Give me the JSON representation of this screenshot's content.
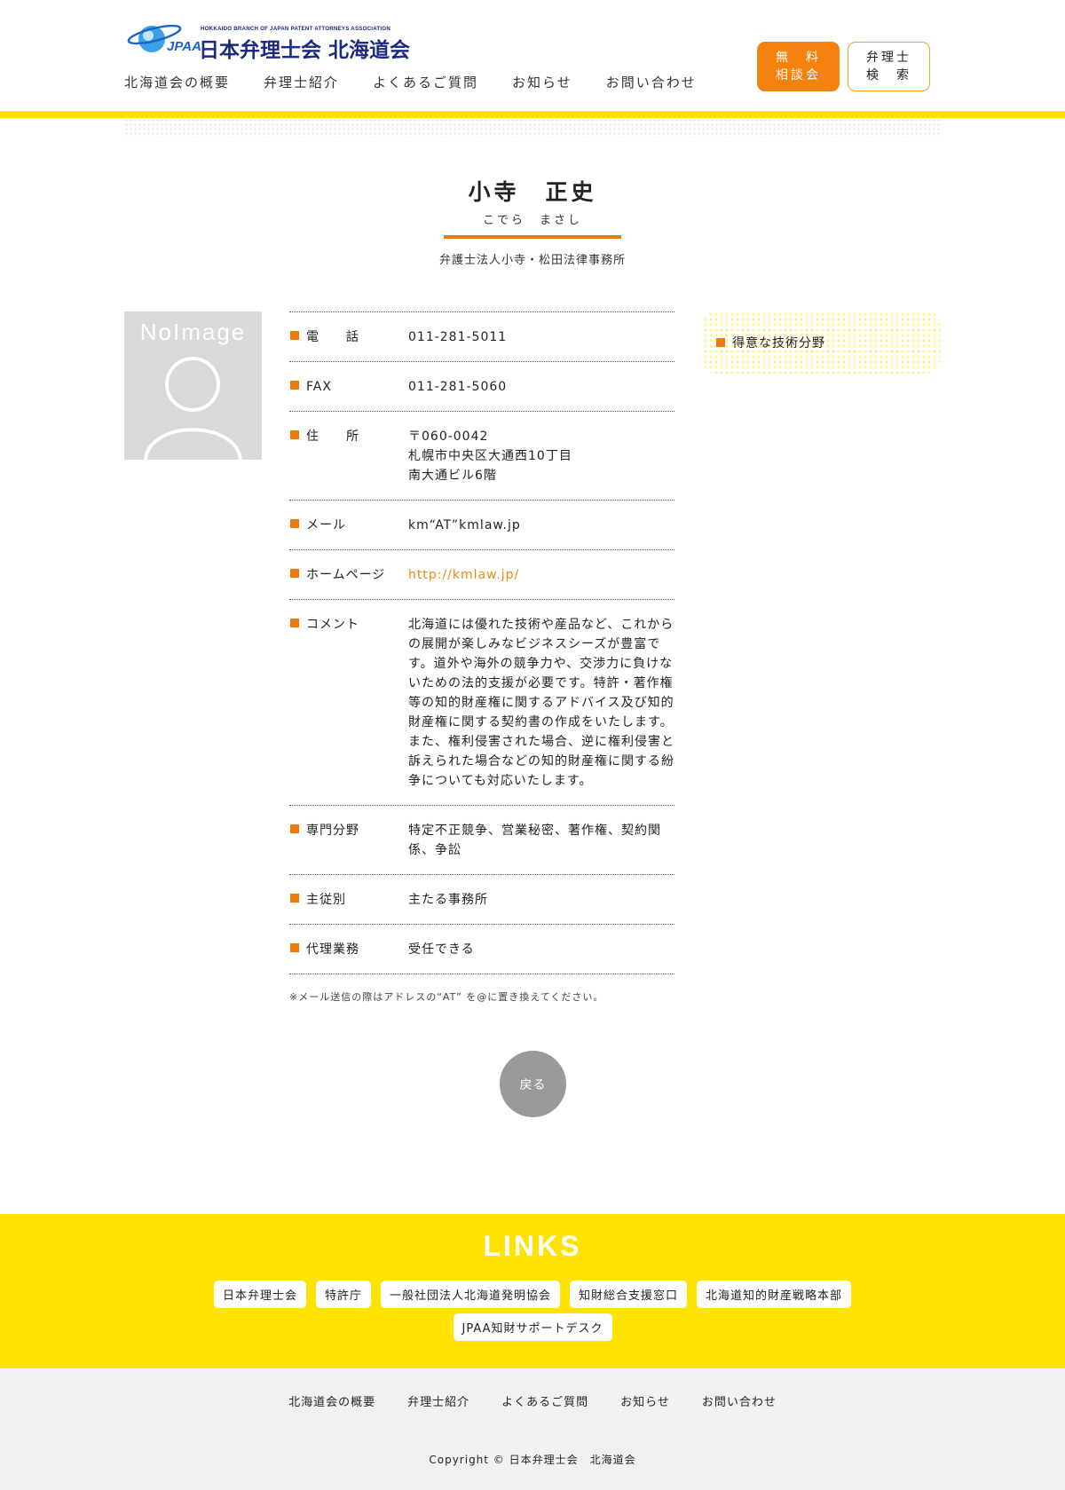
{
  "header": {
    "logo": {
      "mark": "JPAA",
      "english": "HOKKAIDO BRANCH OF JAPAN PATENT ATTORNEYS ASSOCIATION",
      "name": "日本弁理士会 北海道会"
    },
    "nav": [
      "北海道会の概要",
      "弁理士紹介",
      "よくあるご質問",
      "お知らせ",
      "お問い合わせ"
    ],
    "free_button": "無　料\n相談会",
    "search_button": "弁理士\n検　索"
  },
  "profile": {
    "name": "小寺　正史",
    "kana": "こでら　まさし",
    "office": "弁護士法人小寺・松田法律事務所",
    "photo_label": "NoImage",
    "rows": [
      {
        "label": "電　　話",
        "value": "011-281-5011"
      },
      {
        "label": "FAX",
        "value": "011-281-5060"
      },
      {
        "label": "住　　所",
        "value": "〒060-0042\n札幌市中央区大通西10丁目\n南大通ビル6階"
      },
      {
        "label": "メール",
        "value": "km“AT”kmlaw.jp"
      },
      {
        "label": "ホームページ",
        "value": "http://kmlaw.jp/"
      },
      {
        "label": "コメント",
        "value": "北海道には優れた技術や産品など、これからの展開が楽しみなビジネスシーズが豊富です。道外や海外の競争力や、交渉力に負けないための法的支援が必要です。特許・著作権等の知的財産権に関するアドバイス及び知的財産権に関する契約書の作成をいたします。\nまた、権利侵害された場合、逆に権利侵害と訴えられた場合などの知的財産権に関する紛争についても対応いたします。"
      },
      {
        "label": "専門分野",
        "value": "特定不正競争、営業秘密、著作権、契約関係、争訟"
      },
      {
        "label": "主従別",
        "value": "主たる事務所"
      },
      {
        "label": "代理業務",
        "value": "受任できる"
      }
    ],
    "note": "※メール送信の際はアドレスの“AT” を@に置き換えてください。",
    "speciality_title": "得意な技術分野",
    "back_button": "戻る"
  },
  "links": {
    "title": "LINKS",
    "items": [
      "日本弁理士会",
      "特許庁",
      "一般社団法人北海道発明協会",
      "知財総合支援窓口",
      "北海道知的財産戦略本部",
      "JPAA知財サポートデスク"
    ]
  },
  "footer": {
    "nav": [
      "北海道会の概要",
      "弁理士紹介",
      "よくあるご質問",
      "お知らせ",
      "お問い合わせ"
    ],
    "copyright": "Copyright © 日本弁理士会　北海道会"
  },
  "colors": {
    "accent_orange": "#f07a08",
    "brand_yellow": "#ffe300",
    "brand_navy": "#1c2a80",
    "link_orange": "#e88a14"
  }
}
